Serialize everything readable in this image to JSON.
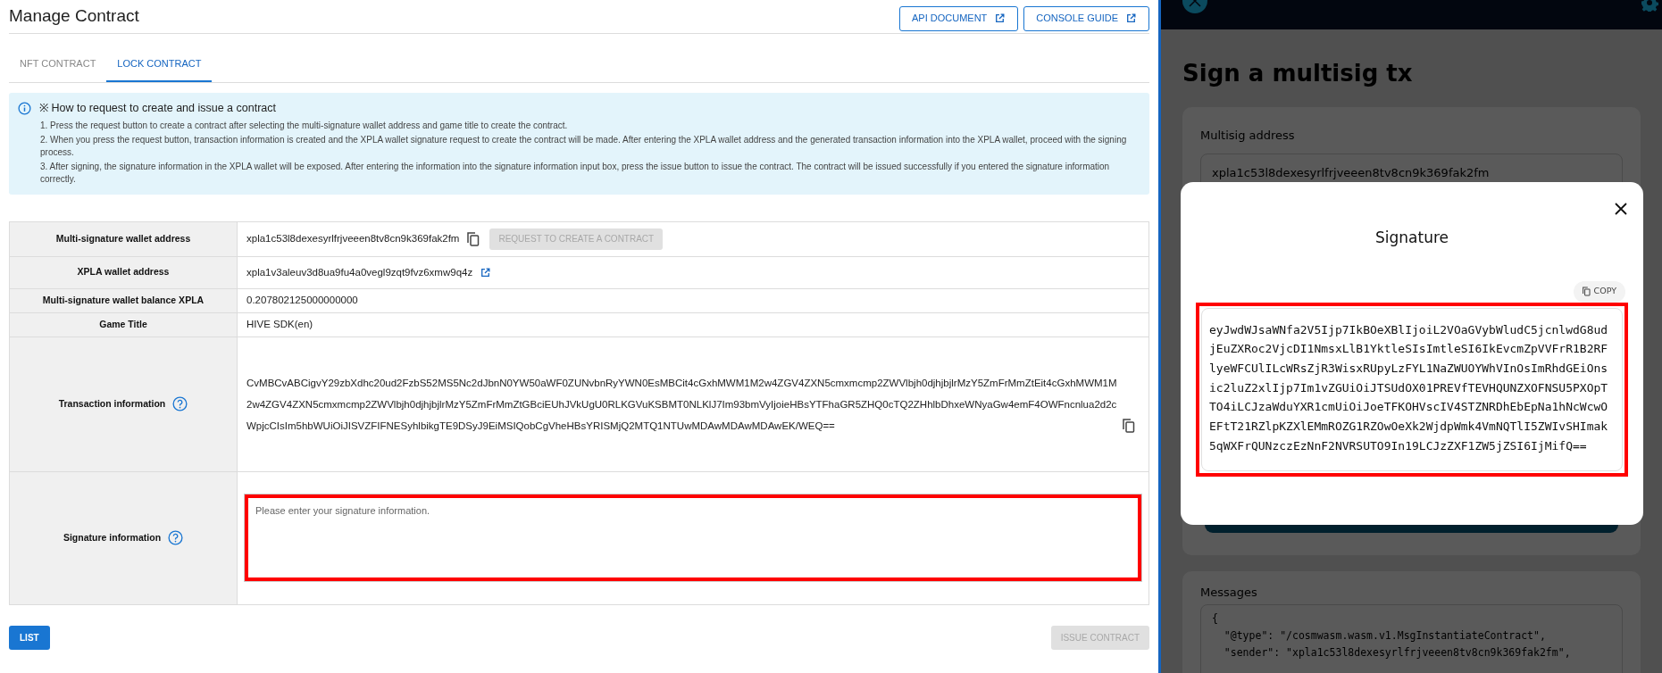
{
  "header": {
    "title": "Manage Contract",
    "buttons": [
      "API DOCUMENT",
      "CONSOLE GUIDE"
    ]
  },
  "tabs": [
    {
      "label": "NFT CONTRACT",
      "selected": false
    },
    {
      "label": "LOCK CONTRACT",
      "selected": true
    }
  ],
  "notice": {
    "title": "※ How to request to create and issue a contract",
    "lines": [
      "1. Press the request button to create a contract after selecting the multi-signature wallet address and game title to create the contract.",
      "2. When you press the request button, transaction information is created and the XPLA wallet signature request to create the contract will be made. After entering the XPLA wallet address and the generated transaction information into the XPLA wallet, proceed with the signing process.",
      "3. After signing, the signature information in the XPLA wallet will be exposed. After entering the information into the signature information input box, press the issue button to issue the contract. The contract will be issued successfully if you entered the signature information correctly."
    ]
  },
  "form": [
    {
      "kind": "address",
      "label": "Multi-signature wallet address",
      "value": "xpla1c53l8dexesyrlfrjveeen8tv8cn9k369fak2fm",
      "button": {
        "label": "REQUEST TO CREATE A CONTRACT",
        "disabled": true
      }
    },
    {
      "kind": "link",
      "label": "XPLA wallet address",
      "value": "xpla1v3aleuv3d8ua9fu4a0vegl9zqt9fvz6xmw9q4z"
    },
    {
      "kind": "text",
      "label": "Multi-signature wallet balance XPLA",
      "value": "0.207802125000000000"
    },
    {
      "kind": "text",
      "label": "Game Title",
      "value": "HIVE SDK(en)"
    },
    {
      "kind": "transaction",
      "label": "Transaction information",
      "value": "CvMBCvABCigvY29zbXdhc20ud2FzbS52MS5Nc2dJbnN0YW50aWF0ZUNvbnRyYWN0EsMBCit4cGxhMWM1M2w4ZGV4ZXN5cmxmcmp2ZWVlbjh0djhjbjlrMzY5ZmFrMmZtEit4cGxhMWM1M2w4ZGV4ZXN5cmxmcmp2ZWVlbjh0djhjbjlrMzY5ZmFrMmZtGBciEUhJVkUgU0RLKGVuKSBMT0NLKlJ7Im93bmVyIjoieHBsYTFhaGR5ZHQ0cTQ2ZHhlbDhxeWNyaGw4emF4OWFncnlua2d2cWpjcCIsIm5hbWUiOiJISVZFIFNESyhlbikgTE9DSyJ9EiMSIQobCgVheHBsYRISMjQ2MTQ1NTUwMDAwMDAwMDAwEK/WEQ=="
    },
    {
      "kind": "signature",
      "label": "Signature information",
      "placeholder": "Please enter your signature information."
    }
  ],
  "footer": {
    "list_button": "LIST",
    "issue_button": {
      "label": "ISSUE CONTRACT",
      "disabled": true
    }
  },
  "wallet": {
    "title": "Sign a multisig tx",
    "multisig_label": "Multisig address",
    "multisig_value": "xpla1c53l8dexesyrlfrjveeen8tv8cn9k369fak2fm",
    "modal": {
      "title": "Signature",
      "copy_label": "COPY",
      "signature": "eyJwdWJsaWNfa2V5Ijp7IkBOeXBlIjoiL2VOaGVybWludC5jcnlwdG8udjEuZXRoc2VjcDI1NmsxLlB1YktleSIsImtleSI6IkEvcmZpVVFrR1B2RFlyeWFCUlILcWRsZjR3WisxRUpyLzFYL1NaZWUOYWhVInOsImRhdGEiOnsic2luZ2xlIjp7Im1vZGUiOiJTSUdOX01PREVfTEVHQUNZXOFNSU5PXOpTTO4iLCJzaWduYXR1cmUiOiJoeTFKOHVscIV4STZNRDhEbEpNa1hNcWcwOEFtT21RZlpKZXlEMmROZG1RZOwOeXk2WjdpWmk4VmNQTlI5ZWIvSHImak5qWXFrQUNzczEzNnF2NVRSUTO9In19LCJzZXF1ZW5jZSI6IjMifQ=="
    },
    "messages": {
      "label": "Messages",
      "lines": [
        "{",
        "  \"@type\": \"/cosmwasm.wasm.v1.MsgInstantiateContract\",",
        "  \"sender\": \"xpla1c53l8dexesyrlfrjveeen8tv8cn9k369fak2fm\","
      ]
    }
  }
}
